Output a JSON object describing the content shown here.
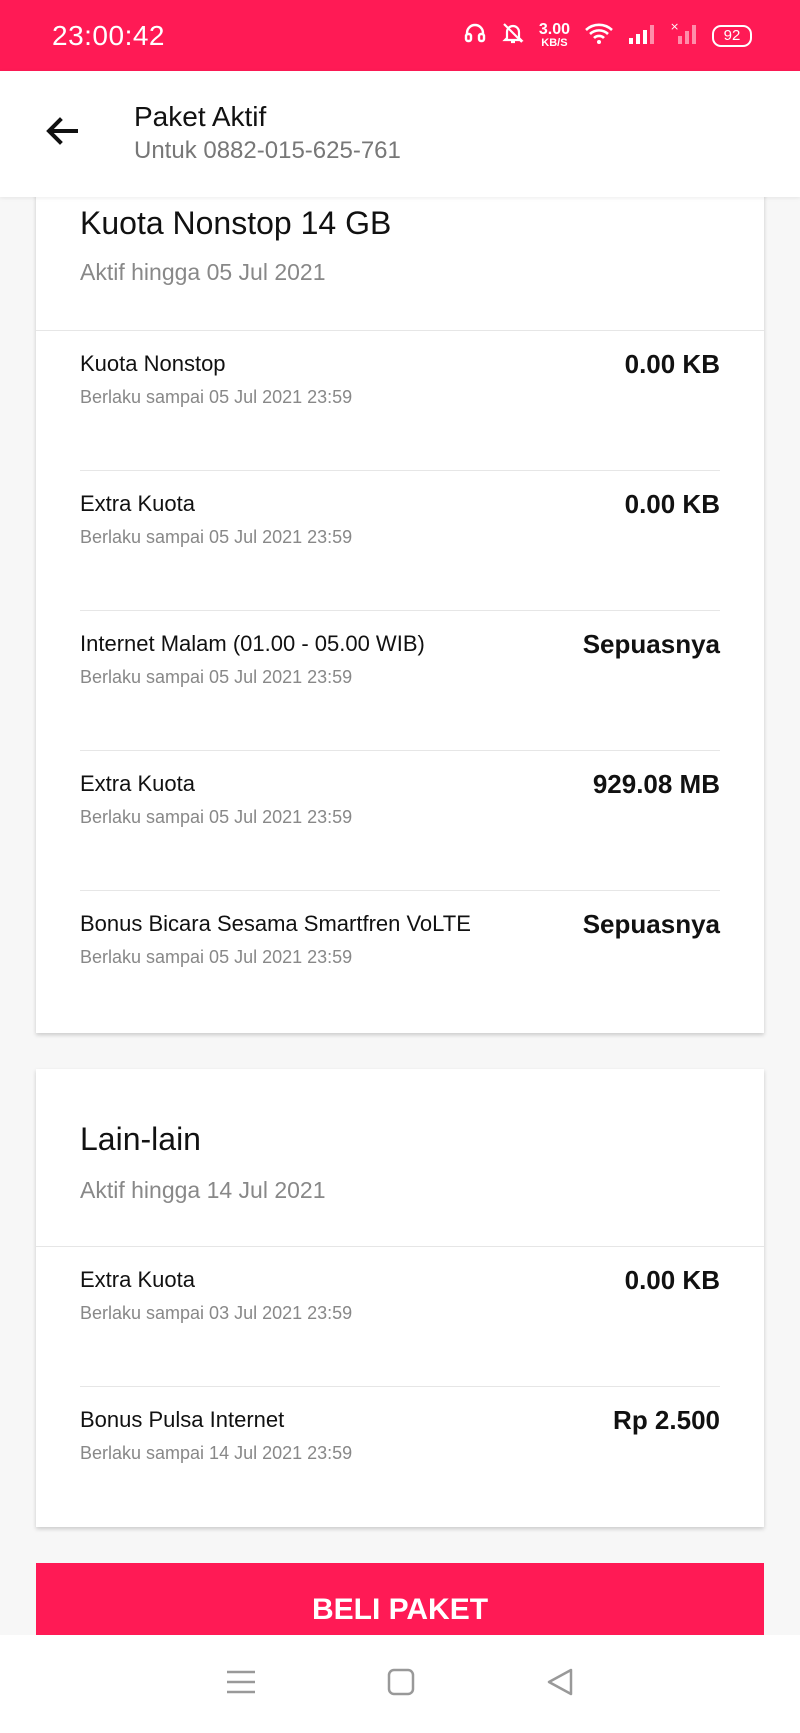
{
  "status_bar": {
    "time": "23:00:42",
    "net_speed_value": "3.00",
    "net_speed_unit": "KB/S",
    "battery": "92",
    "icons": [
      "headset-icon",
      "bell-off-icon",
      "wifi-icon",
      "signal-icon",
      "signal-off-icon",
      "battery-icon"
    ]
  },
  "header": {
    "title": "Paket Aktif",
    "subtitle": "Untuk 0882-015-625-761",
    "back_icon": "arrow-left-icon"
  },
  "packages": [
    {
      "title": "Kuota Nonstop 14 GB",
      "active_until": "Aktif hingga  05 Jul 2021",
      "items": [
        {
          "name": "Kuota Nonstop",
          "expiry": "Berlaku sampai  05 Jul 2021 23:59",
          "value": "0.00 KB"
        },
        {
          "name": "Extra Kuota",
          "expiry": "Berlaku sampai  05 Jul 2021 23:59",
          "value": "0.00 KB"
        },
        {
          "name": "Internet Malam (01.00 - 05.00 WIB)",
          "expiry": "Berlaku sampai  05 Jul 2021 23:59",
          "value": "Sepuasnya"
        },
        {
          "name": "Extra Kuota",
          "expiry": "Berlaku sampai  05 Jul 2021 23:59",
          "value": "929.08 MB"
        },
        {
          "name": "Bonus Bicara Sesama Smartfren VoLTE",
          "expiry": "Berlaku sampai  05 Jul 2021 23:59",
          "value": "Sepuasnya"
        }
      ]
    },
    {
      "title": "Lain-lain",
      "active_until": "Aktif hingga  14 Jul 2021",
      "items": [
        {
          "name": "Extra Kuota",
          "expiry": "Berlaku sampai  03 Jul 2021 23:59",
          "value": "0.00 KB"
        },
        {
          "name": "Bonus Pulsa Internet",
          "expiry": "Berlaku sampai  14 Jul 2021 23:59",
          "value": "Rp 2.500"
        }
      ]
    }
  ],
  "buy_button": {
    "label": "BELI PAKET"
  },
  "colors": {
    "accent": "#ff1a55"
  },
  "nav": [
    "menu-icon",
    "home-square-icon",
    "back-triangle-icon"
  ]
}
